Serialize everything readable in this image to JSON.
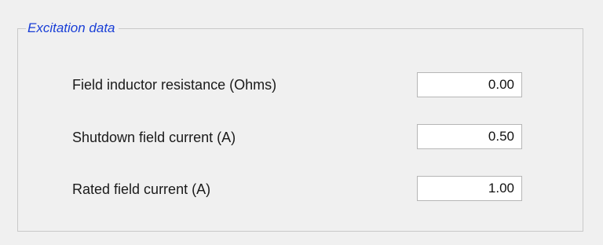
{
  "group": {
    "title": "Excitation data"
  },
  "fields": [
    {
      "label": "Field inductor resistance (Ohms)",
      "value": "0.00"
    },
    {
      "label": "Shutdown field current (A)",
      "value": "0.50"
    },
    {
      "label": "Rated field current (A)",
      "value": "1.00"
    }
  ]
}
